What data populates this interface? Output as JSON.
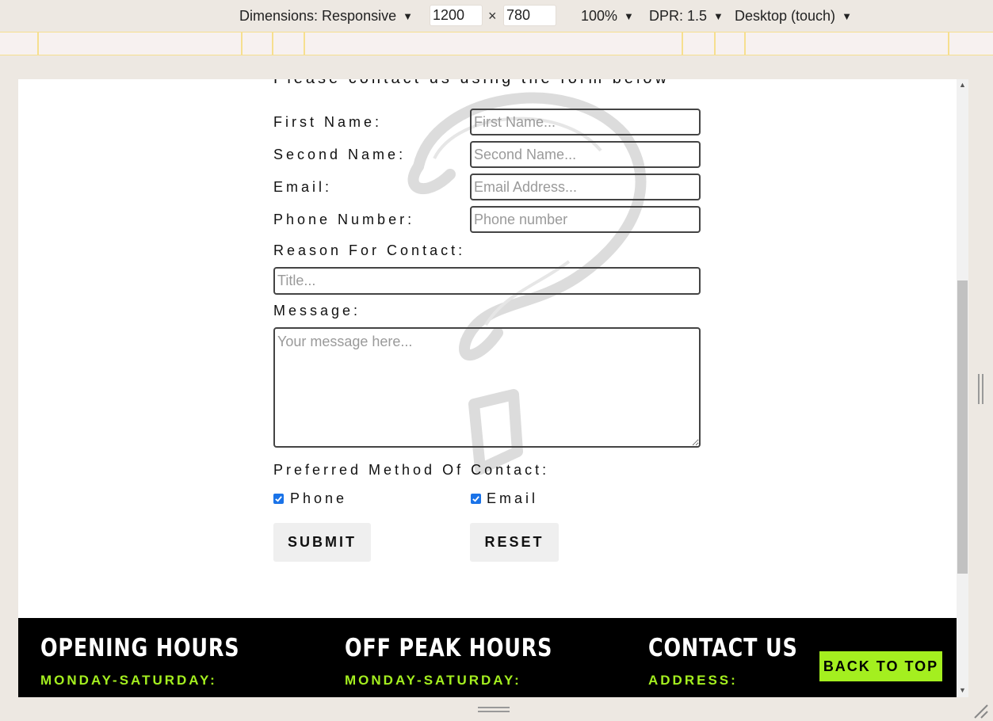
{
  "toolbar": {
    "dimensions_label": "Dimensions: Responsive",
    "width_value": "1200",
    "times_symbol": "×",
    "height_value": "780",
    "zoom": "100%",
    "dpr": "DPR: 1.5",
    "device_mode": "Desktop (touch)"
  },
  "form": {
    "intro": "Please contact us using the form below",
    "first_name": {
      "label": "First Name:",
      "placeholder": "First Name..."
    },
    "second_name": {
      "label": "Second Name:",
      "placeholder": "Second Name..."
    },
    "email": {
      "label": "Email:",
      "placeholder": "Email Address..."
    },
    "phone": {
      "label": "Phone Number:",
      "placeholder": "Phone number"
    },
    "reason": {
      "label": "Reason For Contact:",
      "placeholder": "Title..."
    },
    "message": {
      "label": "Message:",
      "placeholder": "Your message here..."
    },
    "preferred": {
      "label": "Preferred Method Of Contact:",
      "options": [
        {
          "label": "Phone",
          "checked": true
        },
        {
          "label": "Email",
          "checked": true
        }
      ]
    },
    "submit_label": "SUBMIT",
    "reset_label": "RESET"
  },
  "footer": {
    "columns": [
      {
        "title": "OPENING HOURS",
        "sub": "MONDAY-SATURDAY:"
      },
      {
        "title": "OFF PEAK HOURS",
        "sub": "MONDAY-SATURDAY:"
      },
      {
        "title": "CONTACT US",
        "sub": "ADDRESS:"
      }
    ],
    "back_to_top": "BACK TO TOP"
  },
  "colors": {
    "accent": "#a4ef1f",
    "footer_bg": "#000000",
    "checkbox": "#1a73e8"
  }
}
